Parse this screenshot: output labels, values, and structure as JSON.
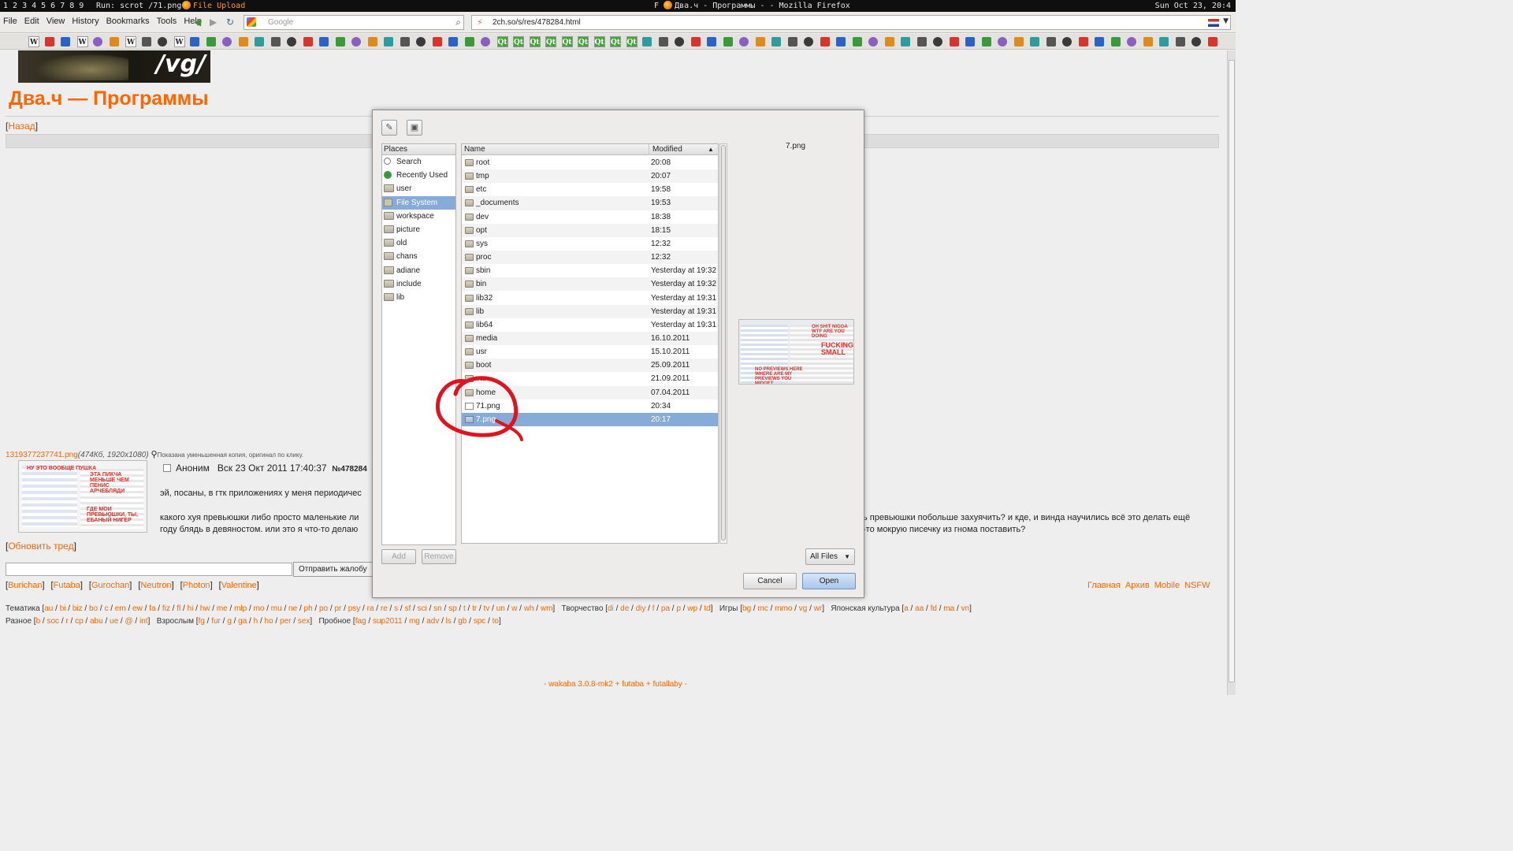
{
  "wmbar": {
    "workspaces": [
      "1",
      "2",
      "3",
      "4",
      "5",
      "6",
      "7",
      "8",
      "9"
    ],
    "run": "Run: scrot /71.png",
    "active_window": "File Upload",
    "title_letter": "F",
    "center_title": "Два.ч - Программы - - Mozilla Firefox",
    "clock": "Sun Oct 23, 20:4"
  },
  "firefox": {
    "menu": [
      "File",
      "Edit",
      "View",
      "History",
      "Bookmarks",
      "Tools",
      "Help"
    ],
    "search_placeholder": "Google",
    "url": "2ch.so/s/res/478284.html"
  },
  "page": {
    "banner_text": "/vg/",
    "board_title": "Два.ч — Программы",
    "back_link": "Назад",
    "post": {
      "filename": "1319377237741.png",
      "file_meta": "(474Кб, 1920x1080)",
      "thumb_note": "Показана уменьшенная копия, оригинал по клику.",
      "thumb_text1": "НУ ЭТО ВООБЩЕ ПУШКА",
      "thumb_text2": "ЭТА ПИКЧА МЕНЬШЕ ЧЕМ ПЕНИС АРЧЕБЛЯДИ",
      "thumb_text3": "ГДЕ МОИ ПРЕВЬЮШКИ, ТЫ, ЕБАНЫЙ НИГЕР",
      "author": "Аноним",
      "date": "Вск 23 Окт 2011 17:40:37",
      "number": "№478284",
      "text_line1": "эй, посаны, в гтк приложениях у меня периодичес",
      "text_line2": "какого хуя превьюшки либо просто маленькие ли",
      "text_line3": "году блядь в девяностом. или это я что-то делаю",
      "text_line4": "ь превьюшки побольше захуячить? и кде, и винда научились всё это делать ещё",
      "text_line5": "-то мокрую писечку из гнома поставить?"
    },
    "refresh_link": "Обновить тред",
    "reply_button": "Отправить жалобу",
    "styles": [
      "Burichan",
      "Futaba",
      "Gurochan",
      "Neutron",
      "Photon",
      "Valentine"
    ],
    "right_links": [
      "Главная",
      "Архив",
      "Mobile",
      "NSFW"
    ],
    "board_line1": [
      {
        "label": "Тематика",
        "boards": [
          "au",
          "bi",
          "biz",
          "bo",
          "c",
          "em",
          "ew",
          "fa",
          "fiz",
          "fl",
          "hi",
          "hw",
          "me",
          "mlp",
          "mo",
          "mu",
          "ne",
          "ph",
          "po",
          "pr",
          "psy",
          "ra",
          "re",
          "s",
          "sf",
          "sci",
          "sn",
          "sp",
          "t",
          "tr",
          "tv",
          "un",
          "w",
          "wh",
          "wm"
        ]
      },
      {
        "label": "Творчество",
        "boards": [
          "di",
          "de",
          "diy",
          "f",
          "pa",
          "p",
          "wp",
          "td"
        ]
      },
      {
        "label": "Игры",
        "boards": [
          "bg",
          "mc",
          "mmo",
          "vg",
          "wr"
        ]
      },
      {
        "label": "Японская культура",
        "boards": [
          "a",
          "aa",
          "fd",
          "ma",
          "vn"
        ]
      }
    ],
    "board_line2": [
      {
        "label": "Разное",
        "boards": [
          "b",
          "soc",
          "r",
          "cp",
          "abu",
          "ue",
          "@",
          "int"
        ]
      },
      {
        "label": "Взрослым",
        "boards": [
          "fg",
          "fur",
          "g",
          "ga",
          "h",
          "ho",
          "per",
          "sex"
        ]
      },
      {
        "label": "Пробное",
        "boards": [
          "fag",
          "sup2011",
          "mg",
          "adv",
          "ls",
          "gb",
          "spc",
          "to"
        ]
      }
    ],
    "footer": [
      "wakaba 3.0.8-mk2",
      "futaba",
      "futallaby"
    ]
  },
  "dialog": {
    "places_header": "Places",
    "places": [
      {
        "label": "Search",
        "icon": "search-icon"
      },
      {
        "label": "Recently Used",
        "icon": "recent-icon"
      },
      {
        "label": "user",
        "icon": "folder-icon"
      },
      {
        "label": "File System",
        "icon": "drive-icon",
        "selected": true
      },
      {
        "label": "workspace",
        "icon": "folder-icon"
      },
      {
        "label": "picture",
        "icon": "folder-icon"
      },
      {
        "label": "old",
        "icon": "folder-icon"
      },
      {
        "label": "chans",
        "icon": "folder-icon"
      },
      {
        "label": "adiane",
        "icon": "folder-icon"
      },
      {
        "label": "include",
        "icon": "folder-icon"
      },
      {
        "label": "lib",
        "icon": "folder-icon"
      }
    ],
    "col_name": "Name",
    "col_modified": "Modified",
    "files": [
      {
        "name": "root",
        "modified": "20:08",
        "type": "folder"
      },
      {
        "name": "tmp",
        "modified": "20:07",
        "type": "folder"
      },
      {
        "name": "etc",
        "modified": "19:58",
        "type": "folder"
      },
      {
        "name": "_documents",
        "modified": "19:53",
        "type": "folder"
      },
      {
        "name": "dev",
        "modified": "18:38",
        "type": "folder"
      },
      {
        "name": "opt",
        "modified": "18:15",
        "type": "folder"
      },
      {
        "name": "sys",
        "modified": "12:32",
        "type": "folder"
      },
      {
        "name": "proc",
        "modified": "12:32",
        "type": "folder"
      },
      {
        "name": "sbin",
        "modified": "Yesterday at 19:32",
        "type": "folder"
      },
      {
        "name": "bin",
        "modified": "Yesterday at 19:32",
        "type": "folder"
      },
      {
        "name": "lib32",
        "modified": "Yesterday at 19:31",
        "type": "folder"
      },
      {
        "name": "lib",
        "modified": "Yesterday at 19:31",
        "type": "folder"
      },
      {
        "name": "lib64",
        "modified": "Yesterday at 19:31",
        "type": "folder"
      },
      {
        "name": "media",
        "modified": "16.10.2011",
        "type": "folder"
      },
      {
        "name": "usr",
        "modified": "15.10.2011",
        "type": "folder"
      },
      {
        "name": "boot",
        "modified": "25.09.2011",
        "type": "folder"
      },
      {
        "name": "var",
        "modified": "21.09.2011",
        "type": "folder"
      },
      {
        "name": "home",
        "modified": "07.04.2011",
        "type": "folder"
      },
      {
        "name": "71.png",
        "modified": "20:34",
        "type": "file"
      },
      {
        "name": "7.png",
        "modified": "20:17",
        "type": "image",
        "selected": true
      }
    ],
    "preview_name": "7.png",
    "preview_text1": "OH SHIT NIGGA WTF ARE YOU DOING",
    "preview_text2": "FUCKING SMALL",
    "preview_text3": "NO PREVIEWS HERE WHERE ARE MY PREVIEWS YOU MIDGET",
    "add_label": "Add",
    "remove_label": "Remove",
    "filter_label": "All Files",
    "cancel_label": "Cancel",
    "open_label": "Open"
  },
  "colors": {
    "accent_orange": "#ff6600",
    "selection_blue": "#86abd9",
    "scribble_red": "#e0141e"
  }
}
